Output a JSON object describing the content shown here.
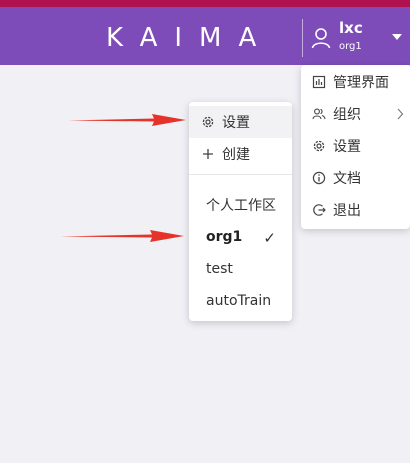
{
  "header": {
    "logo": "KAIMA",
    "user": {
      "name": "lxc",
      "org": "org1"
    }
  },
  "workspace_menu": {
    "settings_label": "设置",
    "create_label": "创建",
    "items": [
      "个人工作区",
      "org1",
      "test",
      "autoTrain"
    ],
    "selected": "org1",
    "check_mark": "✓"
  },
  "user_menu": {
    "items": [
      {
        "label": "管理界面",
        "icon": "dashboard-icon"
      },
      {
        "label": "组织",
        "icon": "team-icon"
      },
      {
        "label": "设置",
        "icon": "gear-icon"
      },
      {
        "label": "文档",
        "icon": "info-icon"
      },
      {
        "label": "退出",
        "icon": "logout-icon"
      }
    ]
  },
  "colors": {
    "header": "#7e4cb8",
    "top_strip": "#b0124f",
    "background": "#f0f0f5",
    "annotation_arrow": "#e5332a"
  }
}
